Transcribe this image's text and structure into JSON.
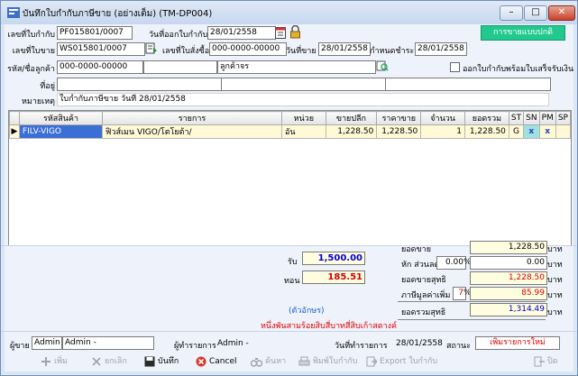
{
  "window": {
    "title": "บันทึกใบกำกับภาษีขาย (อย่างเต็ม) (TM-DP004)"
  },
  "header": {
    "invoice_no_label": "เลขที่ใบกำกับ",
    "invoice_no": "PF015801/0007",
    "issue_date_label": "วันที่ออกใบกำกับ",
    "issue_date": "28/01/2558",
    "sale_type_button": "การขายแบบปกติ",
    "sale_no_label": "เลขที่ใบขาย",
    "sale_no": "WS015801/0007",
    "order_no_label": "เลขที่ใบสั่งซื้อ",
    "order_no": "000-0000-00000",
    "sale_date_label": "วันที่ขาย",
    "sale_date": "28/01/2558",
    "due_date_label": "กำหนดชำระ",
    "due_date": "28/01/2558",
    "customer_label": "รหัส/ชื่อลูกค้า",
    "customer_code": "000-0000-00000",
    "customer_name": "ลูกค้าจร",
    "print_with_receipt_label": "ออกใบกำกับพร้อมใบเสร็จรับเงิน",
    "address_label": "ที่อยู่",
    "note_label": "หมายเหตุ",
    "note": "ใบกำกับภาษีขาย วันที่ 28/01/2558"
  },
  "grid": {
    "columns": [
      "รหัสสินค้า",
      "รายการ",
      "หน่วย",
      "ขายปลีก",
      "ราคาขาย",
      "จำนวน",
      "ยอดรวม",
      "ST",
      "SN",
      "PM",
      "SP"
    ],
    "rows": [
      {
        "code": "FILV-VIGO",
        "desc": "ฟิวส์เมน VIGO/โตโยต้า/",
        "unit": "อัน",
        "retail": "1,228.50",
        "price": "1,228.50",
        "qty": "1",
        "total": "1,228.50",
        "st": "G",
        "sn": "x",
        "pm": "x",
        "sp": ""
      }
    ]
  },
  "summary": {
    "received_label": "รับ",
    "received": "1,500.00",
    "change_label": "ทอน",
    "change": "185.51",
    "amount_text_label": "(ตัวอักษร)",
    "amount_text": "หนึ่งพันสามร้อยสิบสี่บาทสี่สิบเก้าสตางค์",
    "subtotal_label": "ยอดขาย",
    "subtotal": "1,228.50",
    "discount_label": "หัก ส่วนลด",
    "discount_pct": "0.00",
    "discount": "0.00",
    "net_label": "ยอดขายสุทธิ",
    "net": "1,228.50",
    "vat_label": "ภาษีมูลค่าเพิ่ม",
    "vat_pct": "7",
    "vat": "85.99",
    "grand_label": "ยอดรวมสุทธิ",
    "grand": "1,314.49",
    "currency": "บาท",
    "pct_sign": "%"
  },
  "footer": {
    "seller_label": "ผู้ขาย",
    "seller_code": "Admin",
    "seller_name": "Admin -",
    "operator_label": "ผู้ทำรายการ",
    "operator": "Admin -",
    "op_date_label": "วันที่ทำรายการ",
    "op_date": "28/01/2558",
    "status_label": "สถานะ",
    "status": "เพิ่มรายการใหม่"
  },
  "toolbar": {
    "add": "เพิ่ม",
    "cancel_item": "ยกเลิก",
    "save": "บันทึก",
    "cancel": "Cancel",
    "search": "ค้นหา",
    "print": "พิมพ์ใบกำกับ",
    "export": "Export ใบกำกับ",
    "close": "ปิด"
  },
  "colors": {
    "accent_green": "#21c98e",
    "selection_blue": "#3b6fd6",
    "status_red": "#e00000"
  }
}
